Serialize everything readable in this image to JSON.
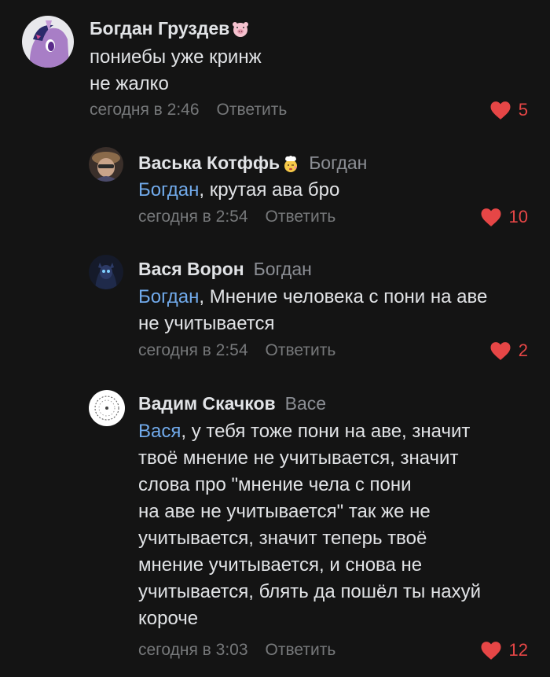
{
  "comments": [
    {
      "author": "Богдан Груздев",
      "author_emoji": "pig-face-emoji",
      "reply_to": "",
      "mention": "",
      "lines": [
        "пониебы уже кринж",
        "не жалко"
      ],
      "time": "сегодня в 2:46",
      "reply_label": "Ответить",
      "likes": "5"
    },
    {
      "author": "Васька Котффь",
      "author_emoji": "cook-emoji",
      "reply_to": "Богдан",
      "mention": "Богдан",
      "lines": [
        ", крутая ава бро"
      ],
      "time": "сегодня в 2:54",
      "reply_label": "Ответить",
      "likes": "10"
    },
    {
      "author": "Вася Ворон",
      "reply_to": "Богдан",
      "mention": "Богдан",
      "lines": [
        ", Мнение человека с пони на аве",
        "не учитывается"
      ],
      "time": "сегодня в 2:54",
      "reply_label": "Ответить",
      "likes": "2"
    },
    {
      "author": "Вадим Скачков",
      "reply_to": "Васе",
      "mention": "Вася",
      "lines": [
        ", у тебя тоже пони на аве, значит",
        "твоё мнение не учитывается, значит",
        "слова про \"мнение чела с пони",
        "на аве не учитывается\" так же не",
        "учитывается, значит теперь твоё",
        "мнение учитывается, и снова не",
        "учитывается, блять да пошёл ты нахуй",
        "короче"
      ],
      "time": "сегодня в 3:03",
      "reply_label": "Ответить",
      "likes": "12"
    }
  ],
  "colors": {
    "background": "#141414",
    "text": "#e1e3e6",
    "secondary": "#76787a",
    "mention": "#71aaeb",
    "like": "#e64646"
  }
}
